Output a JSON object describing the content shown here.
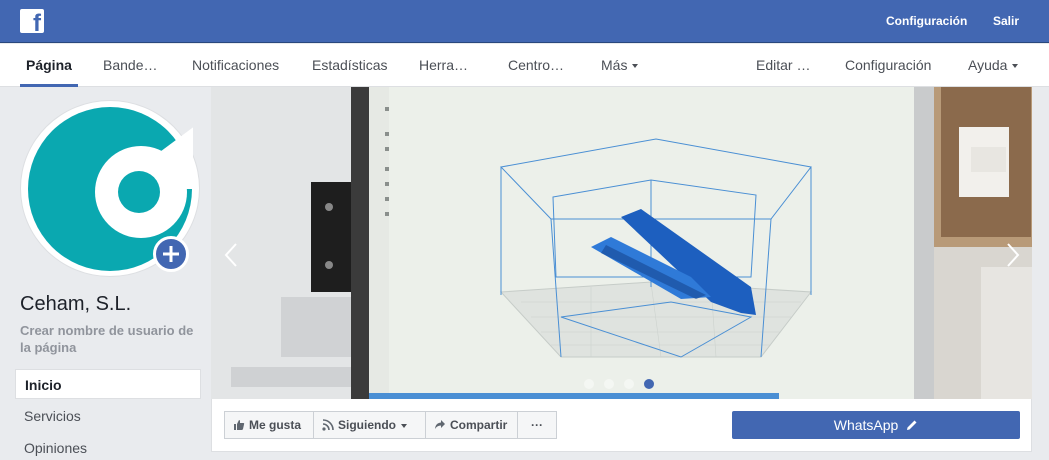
{
  "topbar": {
    "settings_label": "Configuración",
    "logout_label": "Salir",
    "brand_color": "#4267b2"
  },
  "nav": {
    "items": [
      {
        "label": "Página"
      },
      {
        "label": "Bande…"
      },
      {
        "label": "Notificaciones"
      },
      {
        "label": "Estadísticas"
      },
      {
        "label": "Herra…"
      },
      {
        "label": "Centro…"
      },
      {
        "label": "Más"
      },
      {
        "label": "Editar …"
      },
      {
        "label": "Configuración"
      },
      {
        "label": "Ayuda"
      }
    ]
  },
  "page": {
    "name": "Ceham, S.L.",
    "create_username": "Crear nombre de usuario de la página",
    "logo_color": "#0aa8b0"
  },
  "sidebar": {
    "items": [
      {
        "label": "Inicio"
      },
      {
        "label": "Servicios"
      },
      {
        "label": "Opiniones"
      }
    ]
  },
  "cover": {
    "active_slide": 4,
    "slide_count": 4
  },
  "actions": {
    "like_label": "Me gusta",
    "following_label": "Siguiendo",
    "share_label": "Compartir",
    "more_label": "···",
    "whatsapp_label": "WhatsApp"
  }
}
